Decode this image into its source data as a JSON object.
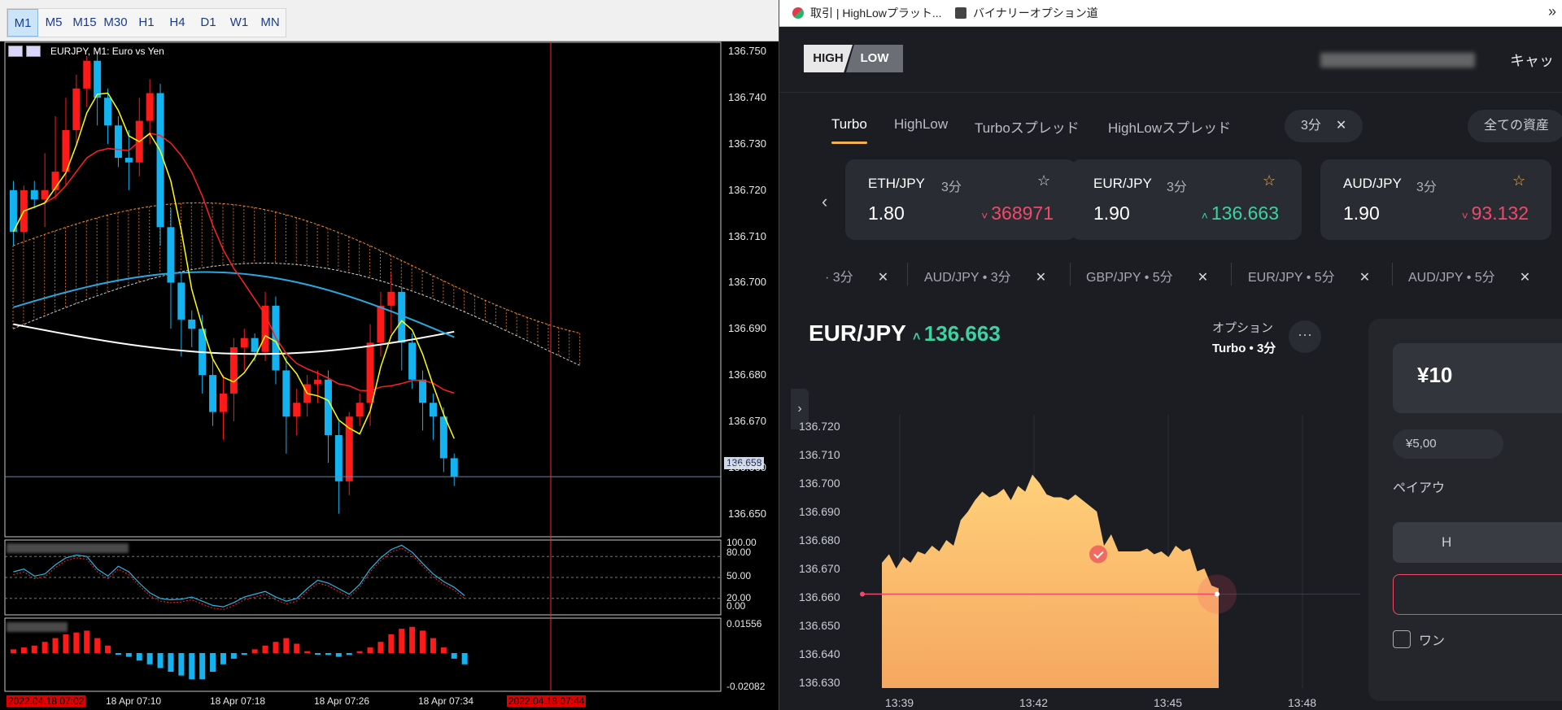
{
  "mt4": {
    "timeframes": [
      "M1",
      "M5",
      "M15",
      "M30",
      "H1",
      "H4",
      "D1",
      "W1",
      "MN"
    ],
    "active_timeframe": "M1",
    "chart_title": "EURJPY, M1:  Euro vs Yen",
    "price_ticks": [
      "136.750",
      "136.740",
      "136.730",
      "136.720",
      "136.710",
      "136.700",
      "136.690",
      "136.680",
      "136.670",
      "136.660",
      "136.650"
    ],
    "current_price": "136.658",
    "stoch_ticks": [
      "100.00",
      "80.00",
      "50.00",
      "20.00",
      "0.00"
    ],
    "osc_ticks": [
      "0.01556",
      "-0.02082"
    ],
    "time_ticks": [
      "2022.04.18 07:02",
      "18 Apr 07:10",
      "18 Apr 07:18",
      "18 Apr 07:26",
      "18 Apr 07:34",
      "2022.04.18 07:44"
    ]
  },
  "browser": {
    "bookmarks": [
      "取引 | HighLowプラット...",
      "バイナリーオプション道"
    ],
    "bookmarks_more": "»",
    "logo": {
      "hi": "HIGH",
      "lo": "LOW"
    },
    "cashback_label": "キャッ",
    "tabs": [
      "Turbo",
      "HighLow",
      "Turboスプレッド",
      "HighLowスプレッド"
    ],
    "active_tab": "Turbo",
    "duration_filter": "3分",
    "asset_filter": "全ての資産",
    "cards": [
      {
        "symbol": "ETH/JPY",
        "duration": "3分",
        "payout": "1.80",
        "price": "368971",
        "direction": "down"
      },
      {
        "symbol": "EUR/JPY",
        "duration": "3分",
        "payout": "1.90",
        "price": "136.663",
        "direction": "up"
      },
      {
        "symbol": "AUD/JPY",
        "duration": "3分",
        "payout": "1.90",
        "price": "93.132",
        "direction": "down"
      }
    ],
    "favorites": [
      "· 3分",
      "AUD/JPY • 3分",
      "GBP/JPY • 5分",
      "EUR/JPY • 5分",
      "AUD/JPY • 5分"
    ],
    "asset": {
      "symbol": "EUR/JPY",
      "price": "136.663",
      "direction": "up"
    },
    "option_label": "オプション",
    "option_value": "Turbo • 3分",
    "option_more": "···",
    "trade": {
      "amount": "¥10",
      "preset": "¥5,00",
      "payout_label": "ペイアウ",
      "high_label": "H",
      "oneclick_label": "ワン"
    }
  },
  "chart_data": [
    {
      "type": "candlestick",
      "title": "EURJPY, M1:  Euro vs Yen",
      "x": [
        "07:02",
        "07:03",
        "07:04",
        "07:05",
        "07:06",
        "07:07",
        "07:08",
        "07:09",
        "07:10",
        "07:11",
        "07:12",
        "07:13",
        "07:14",
        "07:15",
        "07:16",
        "07:17",
        "07:18",
        "07:19",
        "07:20",
        "07:21",
        "07:22",
        "07:23",
        "07:24",
        "07:25",
        "07:26",
        "07:27",
        "07:28",
        "07:29",
        "07:30",
        "07:31",
        "07:32",
        "07:33",
        "07:34",
        "07:35",
        "07:36",
        "07:37",
        "07:38",
        "07:39",
        "07:40",
        "07:41",
        "07:42",
        "07:43",
        "07:44",
        "07:45"
      ],
      "ylim": [
        136.645,
        136.752
      ],
      "ohlc": [
        [
          136.72,
          136.722,
          136.708,
          136.711
        ],
        [
          136.711,
          136.721,
          136.709,
          136.72
        ],
        [
          136.72,
          136.722,
          136.716,
          136.718
        ],
        [
          136.718,
          136.728,
          136.712,
          136.72
        ],
        [
          136.72,
          136.736,
          136.718,
          136.724
        ],
        [
          136.724,
          136.74,
          136.721,
          136.733
        ],
        [
          136.733,
          136.745,
          136.73,
          136.742
        ],
        [
          136.742,
          136.749,
          136.738,
          136.748
        ],
        [
          136.748,
          136.75,
          136.734,
          136.74
        ],
        [
          136.74,
          136.742,
          136.73,
          136.734
        ],
        [
          136.734,
          136.736,
          136.725,
          136.727
        ],
        [
          136.727,
          136.733,
          136.72,
          136.726
        ],
        [
          136.726,
          136.74,
          136.723,
          136.735
        ],
        [
          136.735,
          136.744,
          136.73,
          136.741
        ],
        [
          136.741,
          136.743,
          136.708,
          136.712
        ],
        [
          136.712,
          136.716,
          136.69,
          136.7
        ],
        [
          136.7,
          136.702,
          136.684,
          136.692
        ],
        [
          136.692,
          136.694,
          136.686,
          136.69
        ],
        [
          136.69,
          136.693,
          136.676,
          136.68
        ],
        [
          136.68,
          136.684,
          136.669,
          136.672
        ],
        [
          136.672,
          136.68,
          136.666,
          136.676
        ],
        [
          136.676,
          136.688,
          136.67,
          136.686
        ],
        [
          136.686,
          136.69,
          136.681,
          136.688
        ],
        [
          136.688,
          136.689,
          136.683,
          136.685
        ],
        [
          136.685,
          136.698,
          136.683,
          136.695
        ],
        [
          136.695,
          136.697,
          136.678,
          136.681
        ],
        [
          136.681,
          136.684,
          136.663,
          136.671
        ],
        [
          136.671,
          136.677,
          136.667,
          136.674
        ],
        [
          136.674,
          136.68,
          136.671,
          136.678
        ],
        [
          136.678,
          136.681,
          136.674,
          136.679
        ],
        [
          136.679,
          136.681,
          136.661,
          136.667
        ],
        [
          136.667,
          136.67,
          136.65,
          136.657
        ],
        [
          136.657,
          136.672,
          136.654,
          136.671
        ],
        [
          136.671,
          136.676,
          136.669,
          136.674
        ],
        [
          136.674,
          136.691,
          136.669,
          136.687
        ],
        [
          136.687,
          136.698,
          136.684,
          136.695
        ],
        [
          136.695,
          136.702,
          136.689,
          136.698
        ],
        [
          136.698,
          136.699,
          136.681,
          136.687
        ],
        [
          136.687,
          136.689,
          136.677,
          136.679
        ],
        [
          136.679,
          136.681,
          136.668,
          136.674
        ],
        [
          136.674,
          136.676,
          136.666,
          136.671
        ],
        [
          136.671,
          136.673,
          136.659,
          136.662
        ],
        [
          136.662,
          136.663,
          136.656,
          136.658
        ]
      ],
      "series": [
        {
          "name": "ichimoku",
          "color": "#ff8c1a"
        },
        {
          "name": "ma-fast",
          "color": "#ffff00"
        },
        {
          "name": "ma-mid",
          "color": "#ff2020"
        },
        {
          "name": "ma-slow",
          "color": "#29a8e0"
        },
        {
          "name": "ma-long",
          "color": "#ffffff"
        }
      ]
    },
    {
      "type": "area",
      "x_ticks": [
        "13:39",
        "13:42",
        "13:45",
        "13:48"
      ],
      "y_ticks": [
        "136.720",
        "136.710",
        "136.700",
        "136.690",
        "136.680",
        "136.670",
        "136.660",
        "136.650",
        "136.640",
        "136.630"
      ],
      "ylim": [
        136.628,
        136.724
      ],
      "y": [
        136.672,
        136.675,
        136.67,
        136.674,
        136.672,
        136.676,
        136.675,
        136.678,
        136.676,
        136.68,
        136.678,
        136.687,
        136.69,
        136.694,
        136.697,
        136.695,
        136.696,
        136.698,
        136.694,
        136.699,
        136.697,
        136.703,
        136.7,
        136.696,
        136.695,
        136.695,
        136.694,
        136.696,
        136.694,
        136.692,
        136.69,
        136.678,
        136.682,
        136.676,
        136.676,
        136.676,
        136.676,
        136.677,
        136.675,
        136.676,
        136.674,
        136.678,
        136.676,
        136.677,
        136.669,
        136.67,
        136.664,
        136.663
      ],
      "strike": 136.661,
      "colors": {
        "fill": "#fcbd66",
        "strike_line": "#f04a6a"
      }
    }
  ]
}
